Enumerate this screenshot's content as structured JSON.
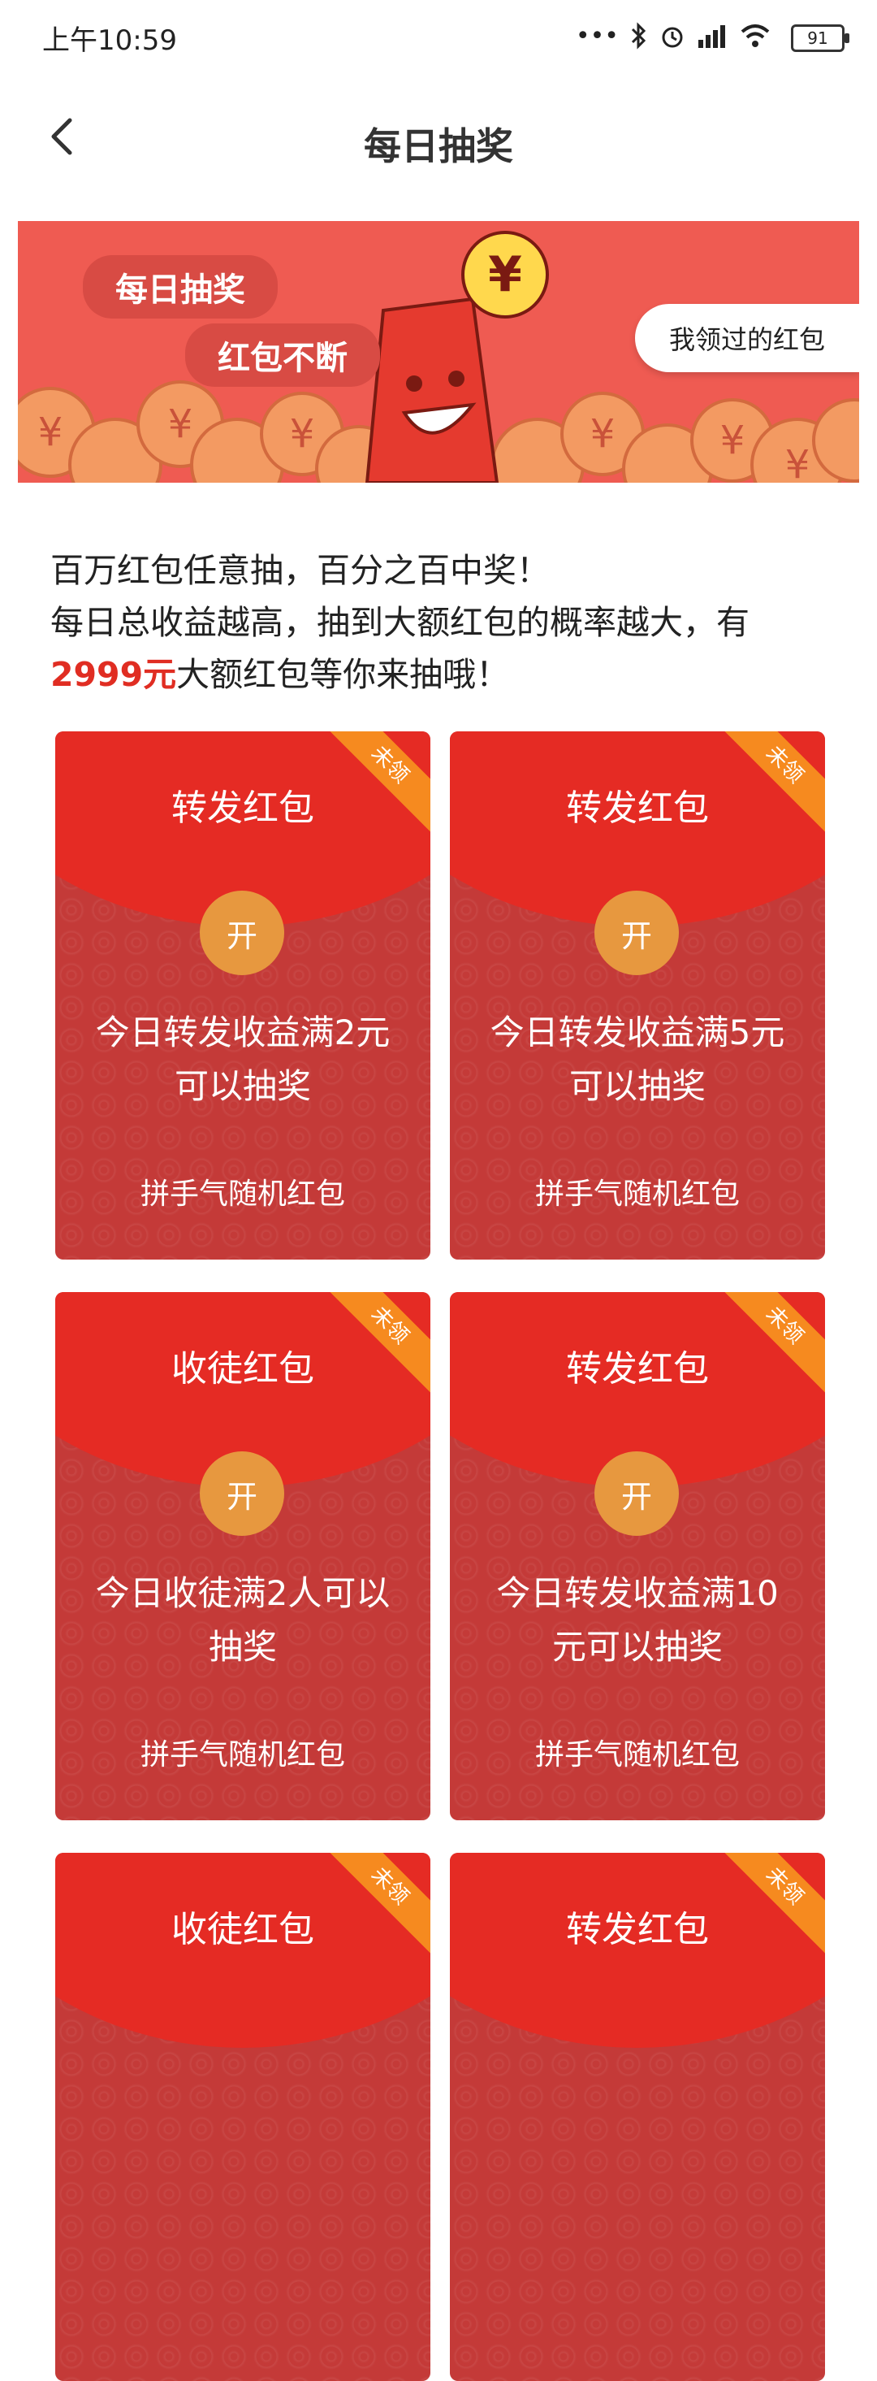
{
  "status_bar": {
    "time": "上午10:59",
    "battery": "91",
    "icons": [
      "more-icon",
      "bluetooth-icon",
      "alarm-icon",
      "signal-icon",
      "wifi-icon",
      "battery-icon"
    ]
  },
  "header": {
    "title": "每日抽奖"
  },
  "banner": {
    "pill_1": "每日抽奖",
    "pill_2": "红包不断",
    "my_redpackets_button": "我领过的红包"
  },
  "intro": {
    "line1": "百万红包任意抽，百分之百中奖！",
    "line2": "每日总收益越高，抽到大额红包的概率越大，有",
    "amount": "2999元",
    "line3": "大额红包等你来抽哦！"
  },
  "cards": [
    {
      "title": "转发红包",
      "open": "开",
      "desc": "今日转发收益满2元可以抽奖",
      "sub": "拼手气随机红包",
      "badge": "未领"
    },
    {
      "title": "转发红包",
      "open": "开",
      "desc": "今日转发收益满5元可以抽奖",
      "sub": "拼手气随机红包",
      "badge": "未领"
    },
    {
      "title": "收徒红包",
      "open": "开",
      "desc": "今日收徒满2人可以抽奖",
      "sub": "拼手气随机红包",
      "badge": "未领"
    },
    {
      "title": "转发红包",
      "open": "开",
      "desc": "今日转发收益满10元可以抽奖",
      "sub": "拼手气随机红包",
      "badge": "未领"
    },
    {
      "title": "收徒红包",
      "badge": "未领"
    },
    {
      "title": "转发红包",
      "badge": "未领"
    }
  ],
  "colors": {
    "accent_red": "#e52b24",
    "card_body": "#c43a38",
    "open_button": "#e7983f",
    "badge_orange": "#f68a1f",
    "banner": "#ef5b52"
  }
}
